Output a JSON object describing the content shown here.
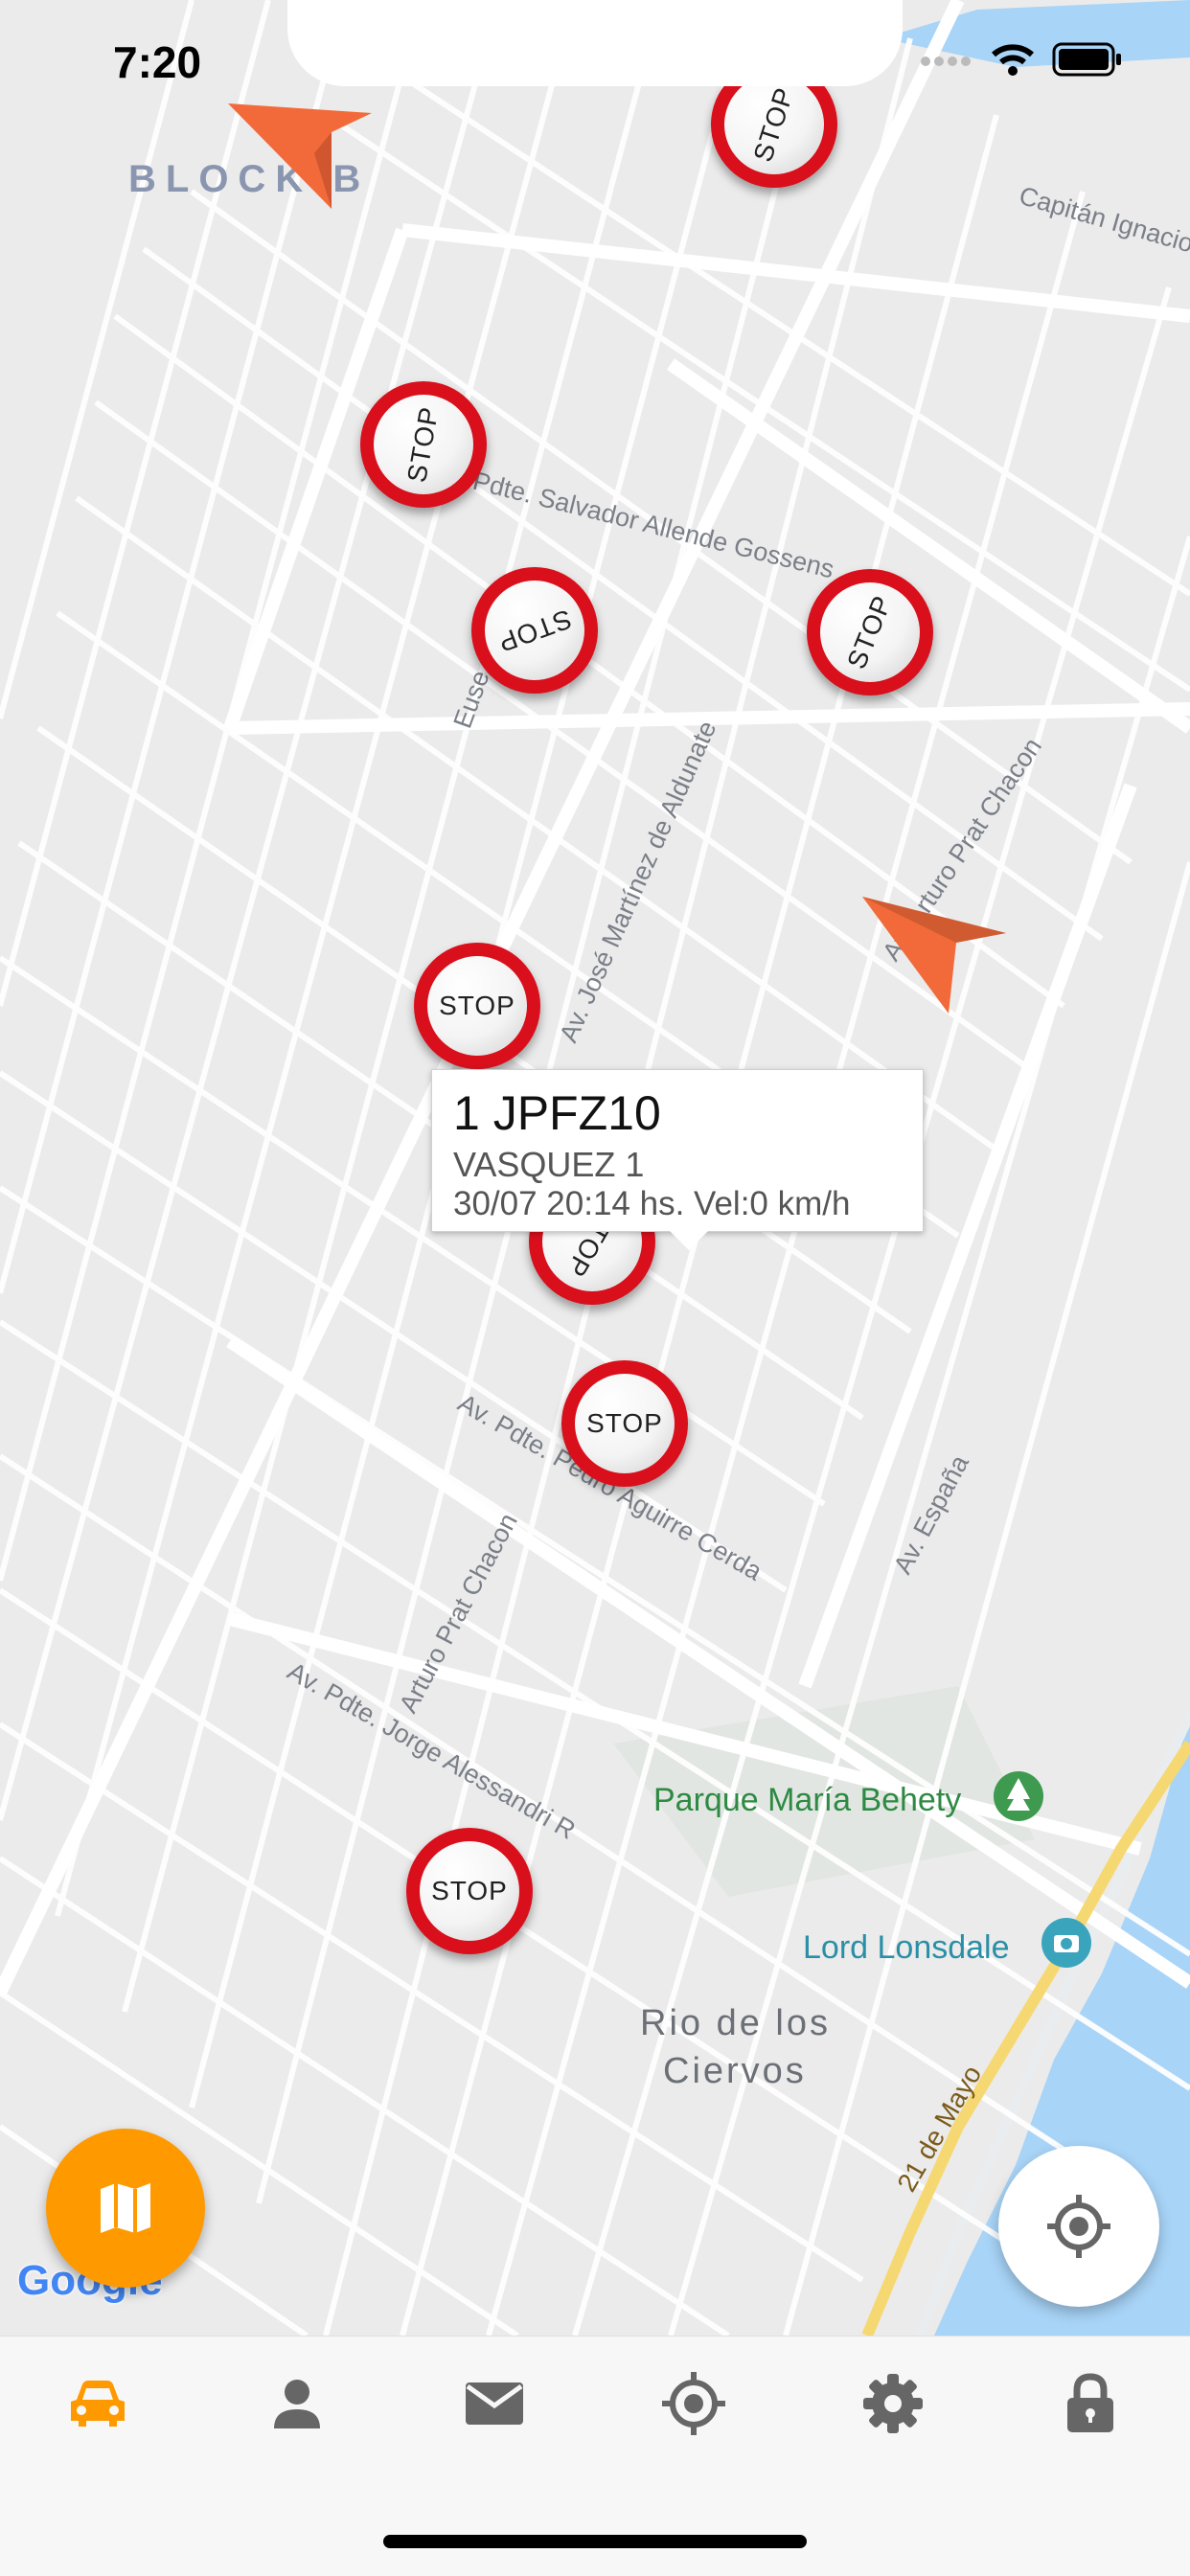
{
  "status_bar": {
    "time": "7:20"
  },
  "map": {
    "area_labels": {
      "block": "BLOCK B",
      "district_line1": "Rio de los",
      "district_line2": "Ciervos"
    },
    "streets": {
      "capitan": "Capitán Ignacio",
      "allende": "Pdte. Salvador Allende Gossens",
      "euse": "Euse",
      "martinez": "Av. José Martínez de Aldunate",
      "prat_top": "Av. Arturo Prat Chacon",
      "aguirre": "Av. Pdte. Pedro Aguirre Cerda",
      "espana": "Av. España",
      "prat_bottom": "Arturo Prat Chacon",
      "alessandri": "Av. Pdte. Jorge Alessandri R",
      "mayo": "21 de Mayo"
    },
    "pois": {
      "park": "Parque María Behety",
      "lonsdale": "Lord Lonsdale"
    },
    "stop_label": "STOP",
    "attribution": "Google"
  },
  "callout": {
    "plate": "1 JPFZ10",
    "driver": "VASQUEZ 1",
    "info": "30/07 20:14 hs. Vel:0 km/h"
  },
  "buttons": {
    "map_type_icon": "map-icon",
    "my_location_icon": "crosshair-icon"
  },
  "tabs": [
    {
      "icon": "car-icon",
      "active": true
    },
    {
      "icon": "person-icon",
      "active": false
    },
    {
      "icon": "mail-icon",
      "active": false
    },
    {
      "icon": "target-icon",
      "active": false
    },
    {
      "icon": "gear-icon",
      "active": false
    },
    {
      "icon": "lock-icon",
      "active": false
    }
  ],
  "colors": {
    "accent": "#ff9900",
    "stop_red": "#d90f1c",
    "water": "#a8d4f7",
    "arrow": "#f26a3a"
  }
}
